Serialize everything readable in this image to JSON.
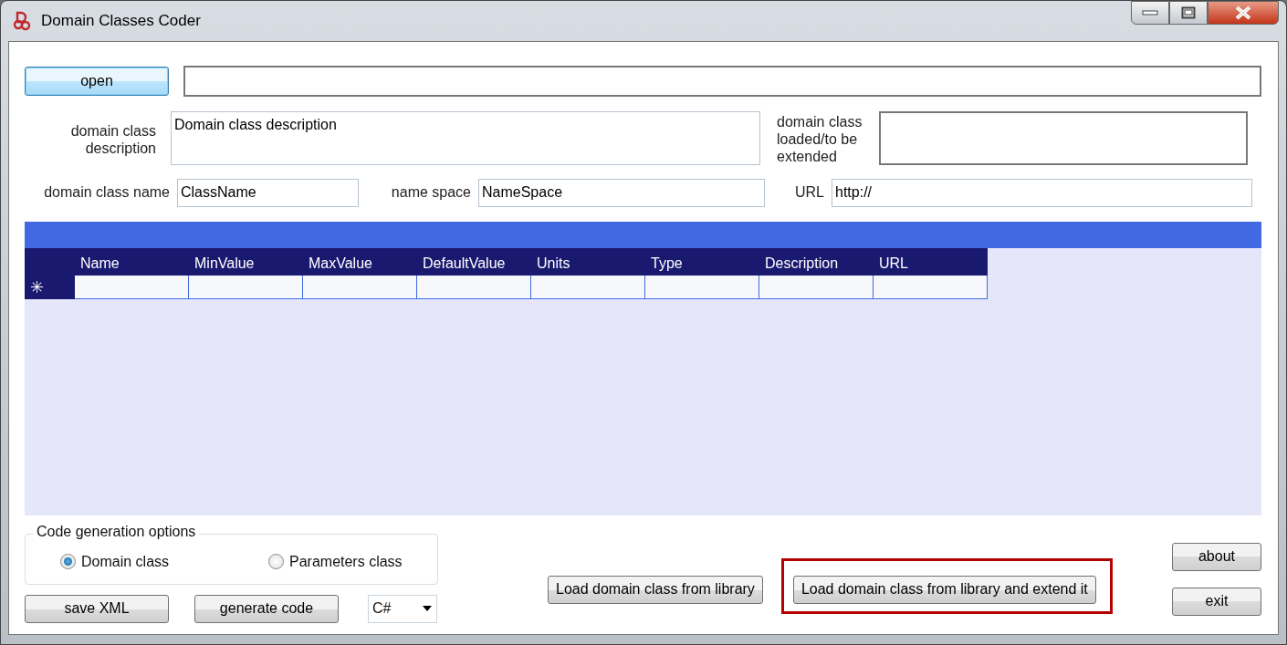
{
  "window": {
    "title": "Domain Classes Coder"
  },
  "open_button": {
    "label": "open"
  },
  "description": {
    "label": "domain class description",
    "value": "Domain class description"
  },
  "loaded_class": {
    "label": "domain class loaded/to be extended"
  },
  "fields": [
    {
      "label": "domain class name",
      "value": "ClassName"
    },
    {
      "label": "name space",
      "value": "NameSpace"
    },
    {
      "label": "URL",
      "value": "http://"
    }
  ],
  "table": {
    "columns": [
      "Name",
      "MinValue",
      "MaxValue",
      "DefaultValue",
      "Units",
      "Type",
      "Description",
      "URL"
    ],
    "new_row_marker": "✳"
  },
  "code_options": {
    "title": "Code generation options",
    "options": [
      {
        "label": "Domain class",
        "selected": true
      },
      {
        "label": "Parameters class",
        "selected": false
      }
    ]
  },
  "language": {
    "value": "C#"
  },
  "buttons": [
    {
      "kind": "save",
      "label": "save XML",
      "highlighted": false
    },
    {
      "kind": "generate",
      "label": "generate code",
      "highlighted": false
    },
    {
      "kind": "load",
      "label": "Load domain class from library",
      "highlighted": false
    },
    {
      "kind": "extend",
      "label": "Load domain class from library and extend it",
      "highlighted": true
    },
    {
      "kind": "about",
      "label": "about",
      "highlighted": false
    },
    {
      "kind": "exit",
      "label": "exit",
      "highlighted": false
    }
  ]
}
